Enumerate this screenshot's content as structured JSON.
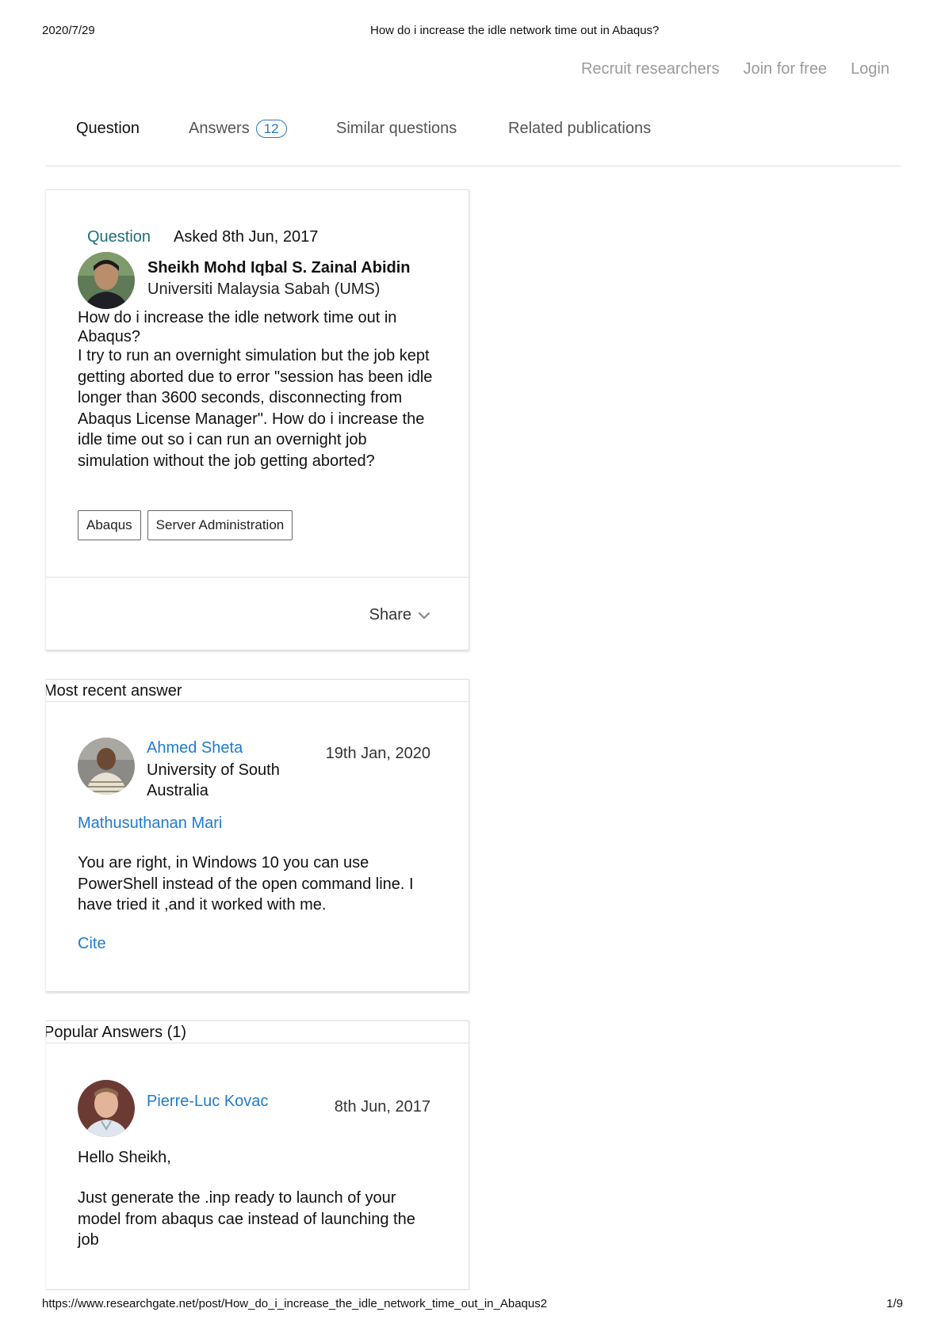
{
  "print_header": {
    "date": "2020/7/29",
    "title": "How do i increase the idle network time out in Abaqus?"
  },
  "top_nav": {
    "recruit": "Recruit researchers",
    "join": "Join for free",
    "login": "Login"
  },
  "tabs": {
    "question": "Question",
    "answers": "Answers",
    "answers_count": "12",
    "similar": "Similar questions",
    "related": "Related publications"
  },
  "question": {
    "type_label": "Question",
    "asked": "Asked 8th Jun, 2017",
    "author": "Sheikh Mohd Iqbal S. Zainal Abidin",
    "institution": "Universiti Malaysia Sabah (UMS)",
    "title": "How do i increase the idle network time out in Abaqus?",
    "body": "I try to run an overnight simulation but the job kept getting aborted due to error \"session has been idle longer than 3600 seconds, disconnecting from Abaqus License Manager\". How do i increase the idle time out so i can run an overnight job simulation without the job getting aborted?",
    "tags": [
      "Abaqus",
      "Server Administration"
    ],
    "share_label": "Share"
  },
  "most_recent": {
    "heading": "Most recent answer",
    "author": "Ahmed Sheta",
    "institution": "University of South Australia",
    "date": "19th Jan, 2020",
    "mention": "Mathusuthanan Mari",
    "body": "You are right, in Windows 10 you can use PowerShell instead of the open command line. I have tried it ,and it worked with me.",
    "cite_label": "Cite"
  },
  "popular": {
    "heading": "Popular Answers (1)",
    "author": "Pierre-Luc Kovac",
    "date": "8th Jun, 2017",
    "greeting": "Hello Sheikh,",
    "body": "Just generate the .inp ready to launch of your model from abaqus cae instead of launching the job"
  },
  "print_footer": {
    "url": "https://www.researchgate.net/post/How_do_i_increase_the_idle_network_time_out_in_Abaqus2",
    "page": "1/9"
  },
  "colors": {
    "link": "#1f7bd1",
    "question_label": "#1d6f78",
    "nav_muted": "#9a9a9a",
    "badge": "#2b78c5"
  },
  "icons": {
    "share_chevron": "chevron-down-icon"
  }
}
